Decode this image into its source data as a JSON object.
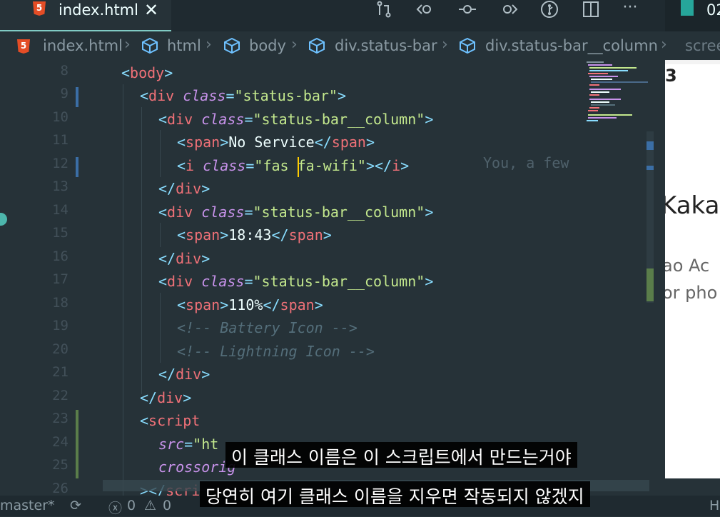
{
  "editor": {
    "active_tab": "index.html",
    "html5_glyph": "5",
    "close_glyph": "✕",
    "second_tab": "02",
    "more_glyph": "···",
    "blame": "You, a few"
  },
  "breadcrumb": {
    "items": [
      "index.html",
      "html",
      "body",
      "div.status-bar",
      "div.status-bar__column"
    ],
    "trailing": "scree"
  },
  "line_numbers": [
    "8",
    "9",
    "10",
    "11",
    "12",
    "13",
    "14",
    "15",
    "16",
    "17",
    "18",
    "19",
    "20",
    "21",
    "22",
    "23",
    "24",
    "25",
    "26"
  ],
  "code": {
    "l8": {
      "o": "<",
      "tag": "body",
      "c": ">"
    },
    "l9": {
      "o": "<",
      "tag": "div",
      "attr": "class",
      "eq": "=",
      "val": "\"status-bar\"",
      "c": ">"
    },
    "l10": {
      "o": "<",
      "tag": "div",
      "attr": "class",
      "eq": "=",
      "val": "\"status-bar__column\"",
      "c": ">"
    },
    "l11": {
      "o": "<",
      "tag": "span",
      "c": ">",
      "text": "No Service",
      "co": "</",
      "ctag": "span",
      "cc": ">"
    },
    "l12": {
      "o": "<",
      "tag": "i",
      "attr": "class",
      "eq": "=",
      "val1": "\"fas",
      "val2": " fa-wifi\"",
      "c": ">",
      "co": "</",
      "ctag": "i",
      "cc": ">"
    },
    "l13": {
      "o": "</",
      "tag": "div",
      "c": ">"
    },
    "l14": {
      "o": "<",
      "tag": "div",
      "attr": "class",
      "eq": "=",
      "val": "\"status-bar__column\"",
      "c": ">"
    },
    "l15": {
      "o": "<",
      "tag": "span",
      "c": ">",
      "text": "18:43",
      "co": "</",
      "ctag": "span",
      "cc": ">"
    },
    "l16": {
      "o": "</",
      "tag": "div",
      "c": ">"
    },
    "l17": {
      "o": "<",
      "tag": "div",
      "attr": "class",
      "eq": "=",
      "val": "\"status-bar__column\"",
      "c": ">"
    },
    "l18": {
      "o": "<",
      "tag": "span",
      "c": ">",
      "text": "110%",
      "co": "</",
      "ctag": "span",
      "cc": ">"
    },
    "l19": {
      "comment": "<!-- Battery Icon -->"
    },
    "l20": {
      "comment": "<!-- Lightning Icon -->"
    },
    "l21": {
      "o": "</",
      "tag": "div",
      "c": ">"
    },
    "l22": {
      "o": "</",
      "tag": "div",
      "c": ">"
    },
    "l23": {
      "o": "<",
      "tag": "script"
    },
    "l24": {
      "attr": "src",
      "eq": "=",
      "val": "\"ht"
    },
    "l25": {
      "attr": "crossorig"
    },
    "l26": {
      "o": "></",
      "tag": "scri"
    }
  },
  "preview": {
    "glyph": "3",
    "title": "Kaka",
    "text1": "ao Ac",
    "text2": "or pho"
  },
  "statusbar": {
    "branch": "master*",
    "errors": "0",
    "warnings": "0",
    "right": "H"
  },
  "subtitles": {
    "line1": "이 클래스 이름은 이 스크립트에서 만드는거야",
    "line2": "당연히 여기 클래스 이름을 지우면 작동되지 않겠지"
  },
  "colors": {
    "background": "#263238",
    "tag": "#f07178",
    "attribute": "#c792ea",
    "string": "#c3e88d",
    "punctuation": "#89ddff",
    "comment": "#546e7a",
    "accent": "#80cbc4",
    "html5": "#e44d26"
  }
}
